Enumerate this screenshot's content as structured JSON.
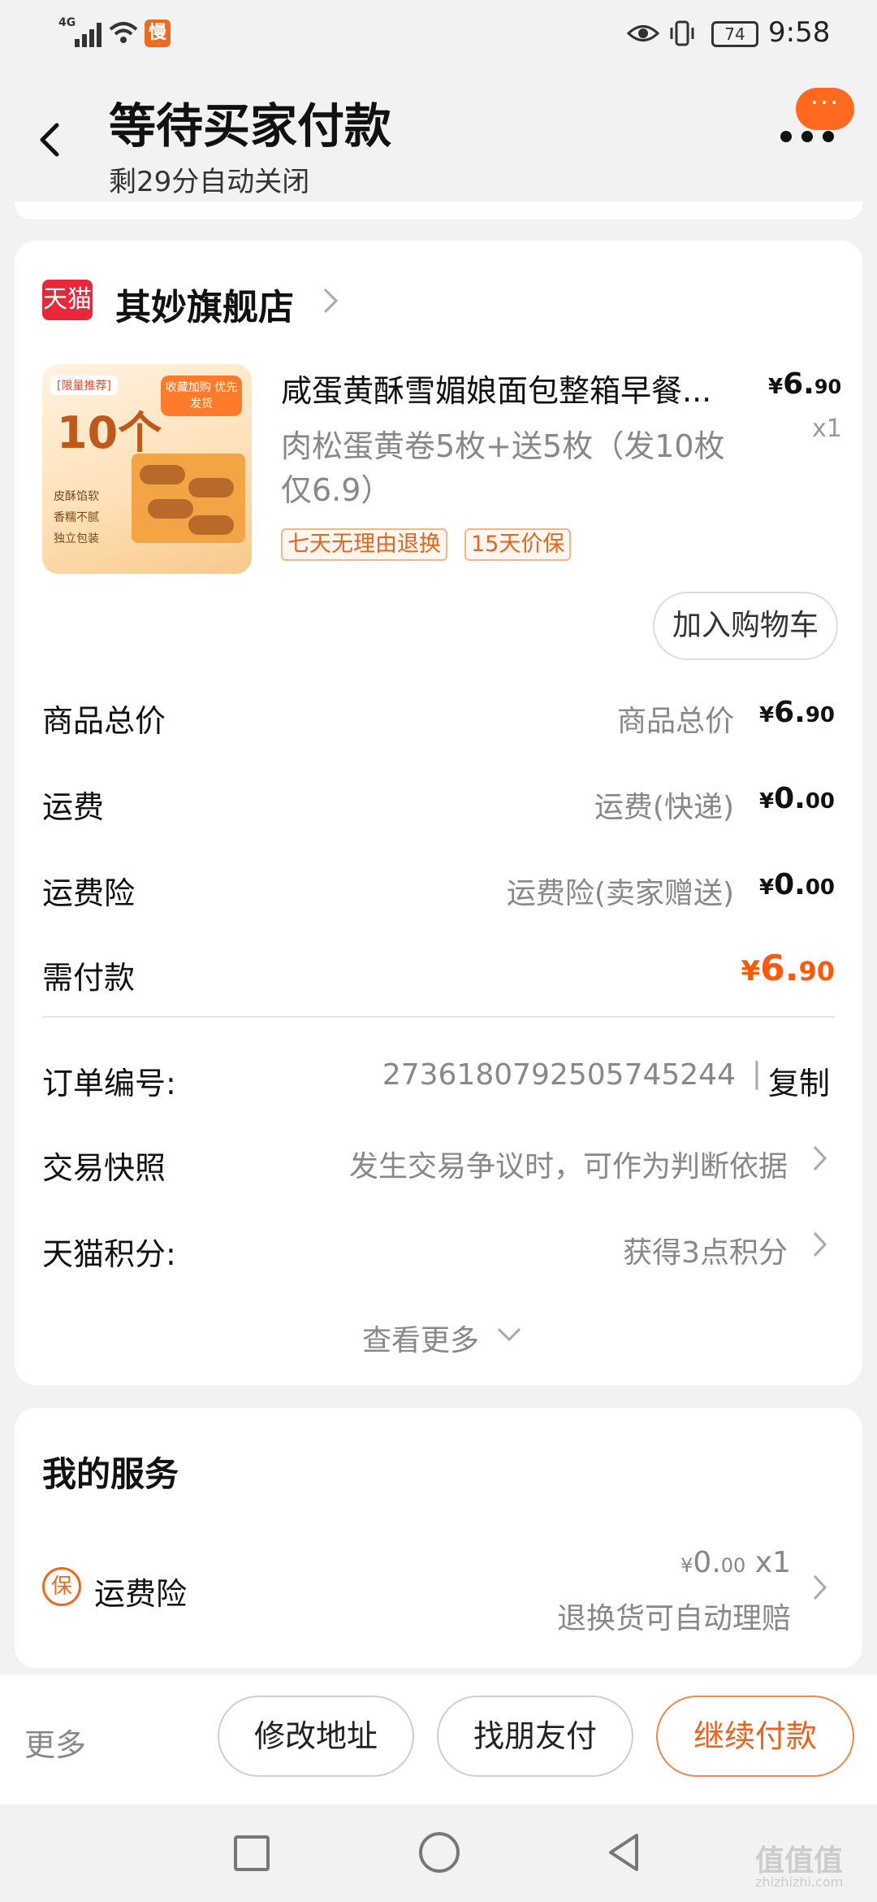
{
  "status_bar": {
    "network": "4G",
    "app_badge": "慢",
    "battery": "74",
    "time": "9:58"
  },
  "header": {
    "title": "等待买家付款",
    "subtitle": "剩29分自动关闭",
    "more_button": "···",
    "accent_color": "#ff6a20"
  },
  "shop": {
    "logo_text": "天猫",
    "name": "其妙旗舰店"
  },
  "product": {
    "image_tag": "[限量推荐]",
    "image_big_text": "10个",
    "image_badge": "收藏加购 优先发货",
    "image_features": [
      "皮酥馅软",
      "香糯不腻",
      "独立包装"
    ],
    "title": "咸蛋黄酥雪媚娘面包整箱早餐...",
    "price_yen": "¥",
    "price_int": "6.",
    "price_dec": "90",
    "qty": "x1",
    "sku": "肉松蛋黄卷5枚+送5枚（发10枚仅6.9）",
    "tags": [
      "七天无理由退换",
      "15天价保"
    ],
    "add_to_cart": "加入购物车"
  },
  "price_rows": [
    {
      "label": "商品总价",
      "desc": "商品总价",
      "yen": "¥",
      "int": "6.",
      "dec": "90"
    },
    {
      "label": "运费",
      "desc": "运费(快递)",
      "yen": "¥",
      "int": "0.",
      "dec": "00"
    },
    {
      "label": "运费险",
      "desc": "运费险(卖家赠送)",
      "yen": "¥",
      "int": "0.",
      "dec": "00"
    },
    {
      "label": "需付款",
      "desc": "",
      "yen": "¥",
      "int": "6.",
      "dec": "90"
    }
  ],
  "info_rows": [
    {
      "label": "订单编号:",
      "value": "2736180792505745244",
      "sep": "|",
      "action": "复制"
    },
    {
      "label": "交易快照",
      "value": "发生交易争议时，可作为判断依据"
    },
    {
      "label": "天猫积分:",
      "value": "获得3点积分"
    }
  ],
  "see_more": "查看更多",
  "services": {
    "title": "我的服务",
    "item": {
      "icon_text": "保",
      "label": "运费险",
      "price_yen": "¥",
      "price_int": "0.",
      "price_dec": "00",
      "qty": "x1",
      "desc": "退换货可自动理赔"
    }
  },
  "bottom_bar": {
    "more": "更多",
    "modify_address": "修改地址",
    "friend_pay": "找朋友付",
    "continue_pay": "继续付款"
  },
  "watermark": {
    "main": "值值值",
    "sub": "zhizhizhi.com"
  }
}
